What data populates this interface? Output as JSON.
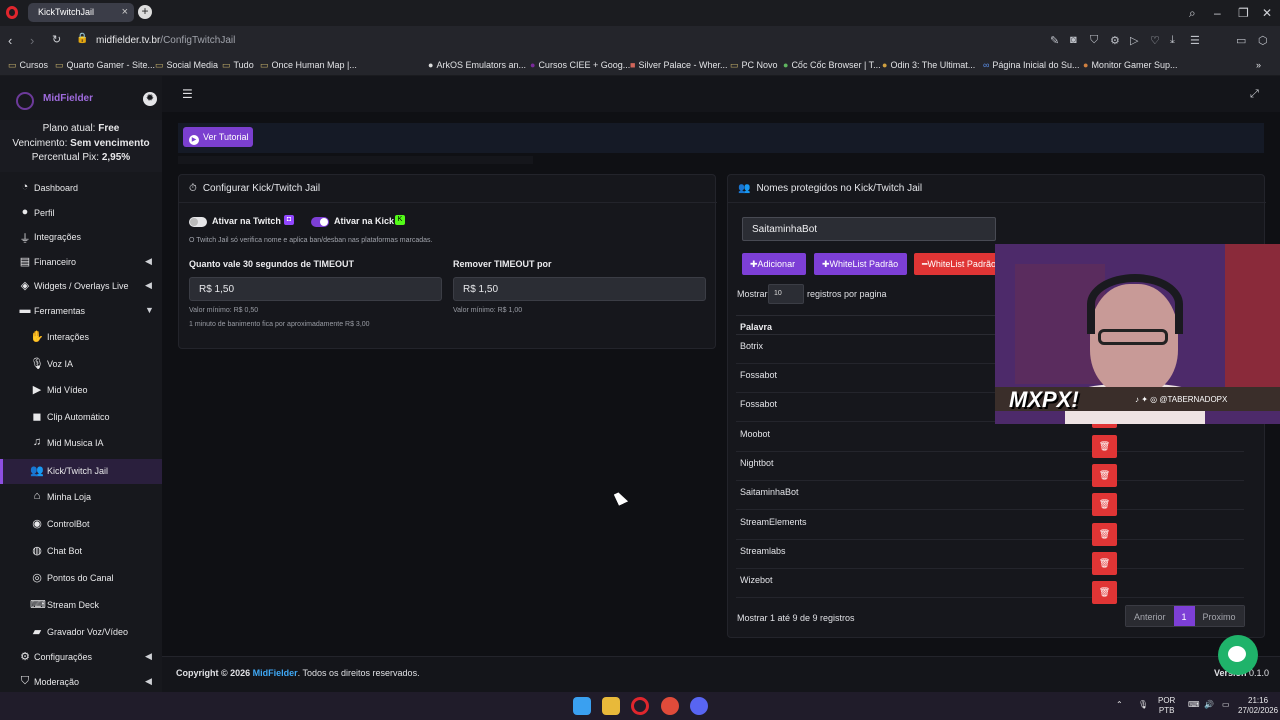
{
  "browser": {
    "tab_title": "KickTwitchJail",
    "url_domain": "midfielder.tv.br",
    "url_path": "/ConfigTwitchJail",
    "bookmarks": [
      "Cursos",
      "Quarto Gamer - Site...",
      "Social Media",
      "Tudo",
      "Once Human Map |...",
      "ArkOS Emulators an...",
      "Cursos CIEE + Goog...",
      "Silver Palace - Wher...",
      "PC Novo",
      "Cốc Cốc Browser | T...",
      "Odin 3: The Ultimat...",
      "Página Inicial do Su...",
      "Monitor Gamer Sup..."
    ]
  },
  "sidebar": {
    "brand": "MidFielder",
    "plan_line1_label": "Plano atual: ",
    "plan_line1_value": "Free",
    "plan_line2_label": "Vencimento: ",
    "plan_line2_value": "Sem vencimento",
    "plan_line3_label": "Percentual Pix: ",
    "plan_line3_value": "2,95%",
    "items": [
      {
        "label": "Dashboard",
        "icon": "dashboard-icon"
      },
      {
        "label": "Perfil",
        "icon": "user-icon"
      },
      {
        "label": "Integrações",
        "icon": "plug-icon"
      },
      {
        "label": "Financeiro",
        "icon": "wallet-icon"
      },
      {
        "label": "Widgets / Overlays Live",
        "icon": "layers-icon"
      },
      {
        "label": "Ferramentas",
        "icon": "toolbox-icon"
      },
      {
        "label": "Interações",
        "icon": "hands-icon"
      },
      {
        "label": "Voz IA",
        "icon": "microphone-icon"
      },
      {
        "label": "Mid Vídeo",
        "icon": "video-icon"
      },
      {
        "label": "Clip Automático",
        "icon": "camera-icon"
      },
      {
        "label": "Mid Musica IA",
        "icon": "music-icon"
      },
      {
        "label": "Kick/Twitch Jail",
        "icon": "users-lock-icon"
      },
      {
        "label": "Minha Loja",
        "icon": "store-icon"
      },
      {
        "label": "ControlBot",
        "icon": "robot-icon"
      },
      {
        "label": "Chat Bot",
        "icon": "chat-icon"
      },
      {
        "label": "Pontos do Canal",
        "icon": "coins-icon"
      },
      {
        "label": "Stream Deck",
        "icon": "keyboard-icon"
      },
      {
        "label": "Gravador Voz/Vídeo",
        "icon": "recorder-icon"
      },
      {
        "label": "Configurações",
        "icon": "gear-icon"
      },
      {
        "label": "Moderação",
        "icon": "shield-icon"
      }
    ]
  },
  "tutorial_label": "Ver Tutorial",
  "config": {
    "title": "Configurar Kick/Twitch Jail",
    "twitch_label": "Ativar na Twitch",
    "kick_label": "Ativar na Kick",
    "note": "O Twitch Jail só verifica nome e aplica ban/desban nas plataformas marcadas.",
    "timeout_label": "Quanto vale 30 segundos de TIMEOUT",
    "timeout_value": "R$ 1,50",
    "timeout_hint": "Valor mínimo: R$ 0,50",
    "timeout_hint2": "1 minuto de banimento fica por aproximadamente R$ 3,00",
    "remove_label": "Remover TIMEOUT por",
    "remove_value": "R$ 1,50",
    "remove_hint": "Valor mínimo: R$ 1,00"
  },
  "protected": {
    "title": "Nomes protegidos no Kick/Twitch Jail",
    "input_value": "SaitaminhaBot",
    "add_label": "Adicionar",
    "whitelist_add_label": "WhiteList Padrão",
    "whitelist_remove_label": "WhiteList Padrão",
    "show_prefix": "Mostrar",
    "page_length": "10",
    "show_suffix": "registros por pagina",
    "column_header": "Palavra",
    "rows": [
      "Botrix",
      "Fossabot",
      "Fossabot",
      "Moobot",
      "Nightbot",
      "SaitaminhaBot",
      "StreamElements",
      "Streamlabs",
      "Wizebot"
    ],
    "footer_text": "Mostrar 1 até 9 de 9 registros",
    "pager_prev": "Anterior",
    "pager_current": "1",
    "pager_next": "Proximo"
  },
  "webcam": {
    "logo_text": "MXPX!",
    "social_handle": "@TABERNADOPX"
  },
  "footer": {
    "copyright_prefix": "Copyright © 2026 ",
    "brand": "MidFielder",
    "copyright_suffix": ". Todos os direitos reservados.",
    "version_label": "Version",
    "version_value": "0.1.0"
  },
  "taskbar": {
    "lang": "POR",
    "layout": "PTB",
    "time": "21:16",
    "date": "27/02/2026"
  },
  "colors": {
    "accent": "#7d3fd6",
    "danger": "#e03535",
    "link": "#3fa8f5",
    "chat": "#1fb36a"
  }
}
